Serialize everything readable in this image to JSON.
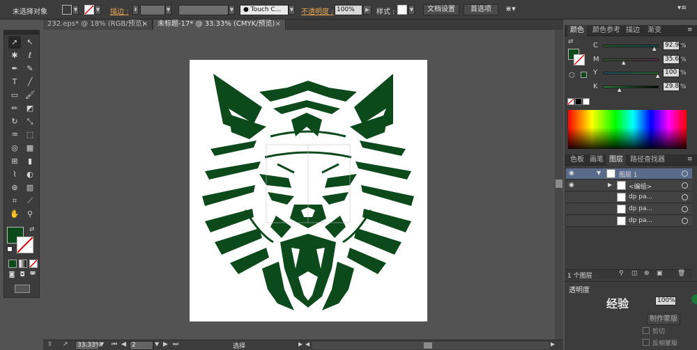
{
  "control_bar": {
    "selection_status": "未选择对象",
    "stroke_label": "描边 :",
    "brush_label": "Touch C...",
    "opacity_label": "不透明度 :",
    "opacity_value": "100%",
    "style_label": "样式 :",
    "doc_setup_button": "文档设置",
    "prefs_button": "首选项",
    "fill_color": "#0c4a1c"
  },
  "tabs": [
    {
      "label": "232.eps* @ 18% (RGB/预览)",
      "close": "×"
    },
    {
      "label": "未标题-17* @ 33.33% (CMYK/预览)",
      "close": "×"
    }
  ],
  "tools": {
    "fill_color": "#0c4a1c"
  },
  "status_bar": {
    "zoom": "33.33%",
    "page": "2",
    "mode": "选择"
  },
  "color_panel": {
    "tabs": [
      "颜色",
      "颜色参考",
      "描边",
      "渐变"
    ],
    "channels": [
      {
        "label": "C",
        "value": "92.94",
        "fraction": 0.93
      },
      {
        "label": "M",
        "value": "35.69",
        "fraction": 0.36
      },
      {
        "label": "Y",
        "value": "100",
        "fraction": 1.0
      },
      {
        "label": "K",
        "value": "29.8",
        "fraction": 0.3
      }
    ]
  },
  "layers_panel": {
    "tabs": [
      "色板",
      "画笔",
      "图层",
      "路径查找器"
    ],
    "rows": [
      {
        "label": "图层 1"
      },
      {
        "label": "<编组>"
      },
      {
        "label": "dp pa..."
      },
      {
        "label": "dp pa..."
      },
      {
        "label": "dp pa..."
      }
    ],
    "count_label": "1 个图层"
  },
  "transparency_panel": {
    "title": "透明度",
    "opacity_value": "100%",
    "make_mask_button": "制作蒙版",
    "clip_label": "剪切",
    "invert_label": "反相蒙版",
    "watermark": "经验"
  }
}
